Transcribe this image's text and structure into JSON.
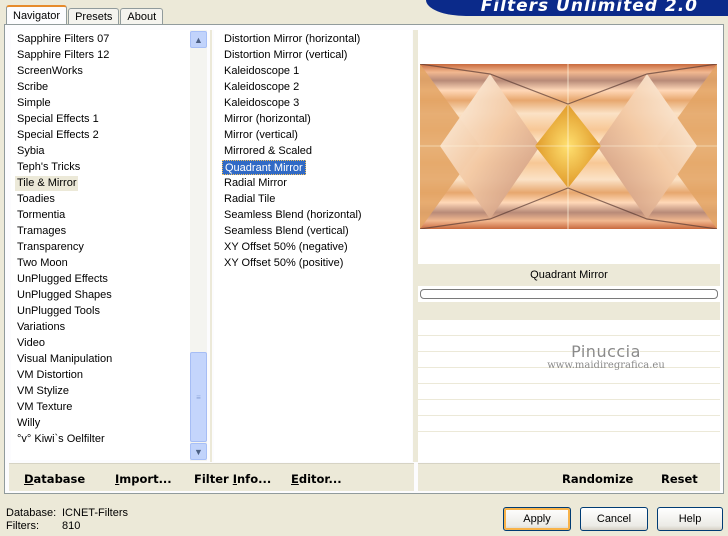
{
  "app": {
    "title": "Filters Unlimited 2.0"
  },
  "tabs": [
    {
      "label": "Navigator",
      "active": true
    },
    {
      "label": "Presets",
      "active": false
    },
    {
      "label": "About",
      "active": false
    }
  ],
  "categories": [
    "Sapphire Filters 07",
    "Sapphire Filters 12",
    "ScreenWorks",
    "Scribe",
    "Simple",
    "Special Effects 1",
    "Special Effects 2",
    "Sybia",
    "Teph's Tricks",
    "Tile & Mirror",
    "Toadies",
    "Tormentia",
    "Tramages",
    "Transparency",
    "Two Moon",
    "UnPlugged Effects",
    "UnPlugged Shapes",
    "UnPlugged Tools",
    "Variations",
    "Video",
    "Visual Manipulation",
    "VM Distortion",
    "VM Stylize",
    "VM Texture",
    "Willy",
    "°v° Kiwi`s Oelfilter"
  ],
  "selected_category": "Tile & Mirror",
  "filters": [
    "Distortion Mirror (horizontal)",
    "Distortion Mirror (vertical)",
    "Kaleidoscope 1",
    "Kaleidoscope 2",
    "Kaleidoscope 3",
    "Mirror (horizontal)",
    "Mirror (vertical)",
    "Mirrored & Scaled",
    "Quadrant Mirror",
    "Radial Mirror",
    "Radial Tile",
    "Seamless Blend (horizontal)",
    "Seamless Blend (vertical)",
    "XY Offset 50% (negative)",
    "XY Offset 50% (positive)"
  ],
  "selected_filter": "Quadrant Mirror",
  "preview": {
    "filter_name": "Quadrant Mirror",
    "progress": 0
  },
  "watermark": {
    "line1": "Pinuccia",
    "line2": "www.maidiregrafica.eu"
  },
  "toolbar": {
    "database": {
      "u": "D",
      "rest": "atabase"
    },
    "import": {
      "u": "I",
      "rest": "mport..."
    },
    "filter_info": {
      "pre": "Filter ",
      "u": "I",
      "rest": "nfo..."
    },
    "editor": {
      "u": "E",
      "rest": "ditor..."
    },
    "randomize": "Randomize",
    "reset": "Reset"
  },
  "status": {
    "database_label": "Database:",
    "database_value": "ICNET-Filters",
    "filters_label": "Filters:",
    "filters_value": "810"
  },
  "buttons": {
    "apply": "Apply",
    "cancel": "Cancel",
    "help": "Help"
  },
  "colors": {
    "selection": "#316ac5",
    "banner": "#0b2a8a",
    "tab_accent": "#e68b2c"
  }
}
